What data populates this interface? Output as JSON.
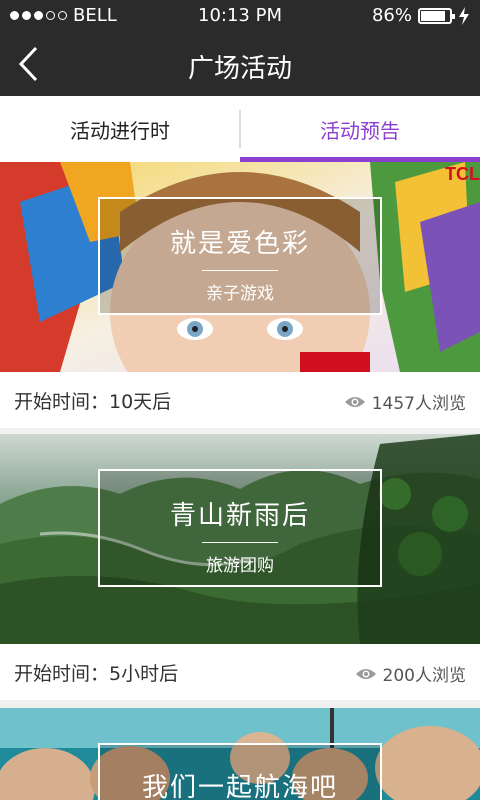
{
  "status": {
    "carrier": "BELL",
    "time": "10:13 PM",
    "battery": "86%",
    "battery_level": 0.86
  },
  "header": {
    "title": "广场活动"
  },
  "tabs": [
    {
      "label": "活动进行时"
    },
    {
      "label": "活动预告"
    }
  ],
  "cards": [
    {
      "title": "就是爱色彩",
      "subtitle": "亲子游戏",
      "start": "开始时间：10天后",
      "views": "1457人浏览",
      "image_text": "TCL"
    },
    {
      "title": "青山新雨后",
      "subtitle": "旅游团购",
      "start": "开始时间：5小时后",
      "views": "200人浏览"
    },
    {
      "title": "我们一起航海吧"
    }
  ]
}
